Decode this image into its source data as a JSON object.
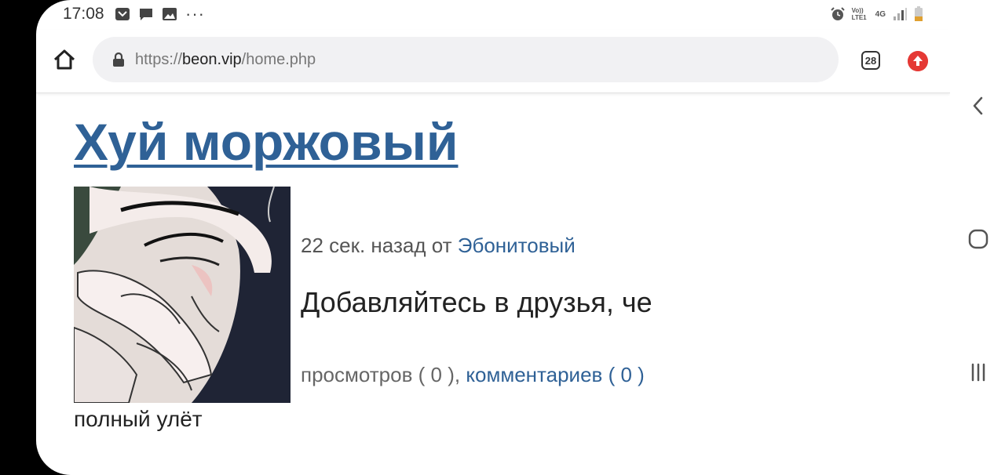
{
  "status_bar": {
    "time": "17:08",
    "left_icons": [
      "email-notification-icon",
      "message-notification-icon",
      "gallery-notification-icon",
      "more-dots-icon"
    ],
    "right_icons": [
      "alarm-icon",
      "volte-icon",
      "4g-icon",
      "signal-icon",
      "battery-icon"
    ],
    "volte_label": "Vo)) LTE1",
    "network_label": "4G",
    "more_dots": "···"
  },
  "browser": {
    "url_scheme": "https://",
    "url_host": "beon.vip",
    "url_path": "/home.php",
    "tab_count": "28"
  },
  "post": {
    "title": "Хуй моржовый",
    "time_ago": "22 сек. назад от ",
    "author": "Эбонитовый",
    "text": "Добавляйтесь в друзья, че",
    "views": "просмотров ( 0 ), ",
    "comments": "комментариев ( 0 )",
    "caption": "полный улёт"
  },
  "colors": {
    "link": "#2f6196",
    "update_badge": "#e53935"
  }
}
